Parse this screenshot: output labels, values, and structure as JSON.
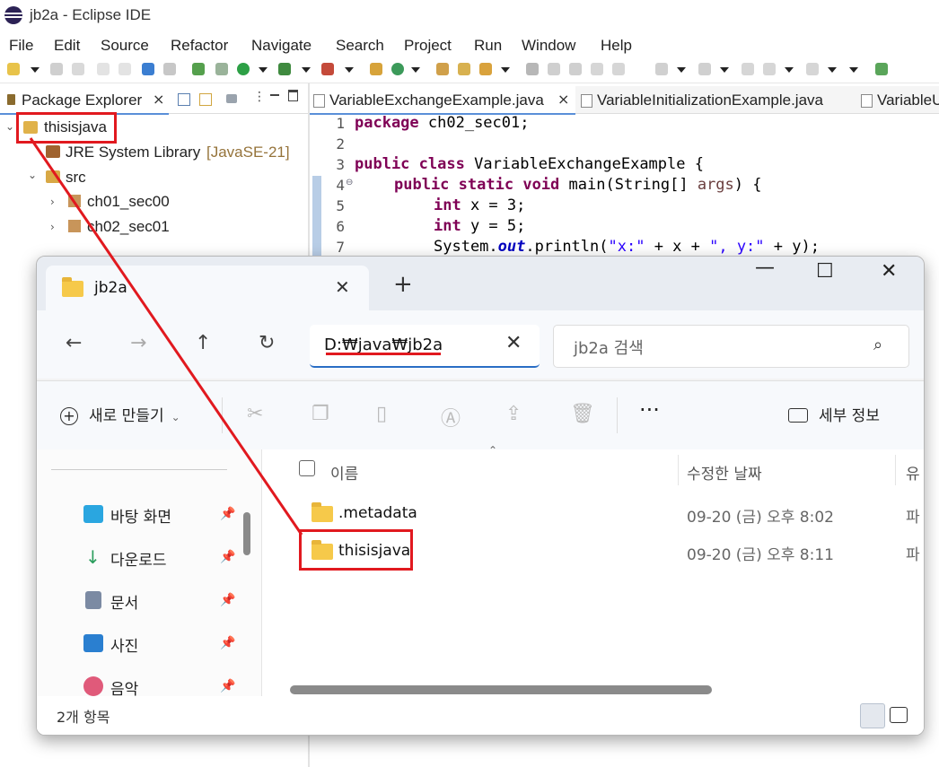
{
  "eclipse": {
    "window_title": "jb2a - Eclipse IDE",
    "menu": [
      "File",
      "Edit",
      "Source",
      "Refactor",
      "Navigate",
      "Search",
      "Project",
      "Run",
      "Window",
      "Help"
    ],
    "package_explorer": {
      "tab_label": "Package Explorer",
      "close": "×",
      "tree": {
        "project": "thisisjava",
        "jre": "JRE System Library",
        "jre_version": "[JavaSE-21]",
        "src": "src",
        "packages": [
          "ch01_sec00",
          "ch02_sec01"
        ]
      }
    },
    "editor": {
      "tabs": [
        "VariableExchangeExample.java",
        "VariableInitializationExample.java",
        "VariableU"
      ],
      "line_numbers": [
        "1",
        "2",
        "3",
        "4",
        "5",
        "6",
        "7"
      ],
      "code": {
        "l1_kw": "package",
        "l1_rest": " ch02_sec01;",
        "l3_kw1": "public",
        "l3_kw2": "class",
        "l3_rest": " VariableExchangeExample {",
        "l4_kw1": "public",
        "l4_kw2": "static",
        "l4_kw3": "void",
        "l4_rest1": " main(String[] ",
        "l4_param": "args",
        "l4_rest2": ") {",
        "l5_kw": "int",
        "l5_rest": " x = 3;",
        "l6_kw": "int",
        "l6_rest": " y = 5;",
        "l7_a": "System.",
        "l7_field": "out",
        "l7_b": ".println(",
        "l7_s1": "\"x:\"",
        "l7_c": " + x + ",
        "l7_s2": "\", y:\"",
        "l7_d": " + y);"
      }
    }
  },
  "explorer": {
    "tab_title": "jb2a",
    "tab_close": "✕",
    "new_tab": "+",
    "window_buttons": {
      "minimize": "—",
      "maximize": "☐",
      "close": "✕"
    },
    "nav": {
      "back": "←",
      "forward": "→",
      "up": "↑",
      "refresh": "↻"
    },
    "address": "D:₩java₩jb2a",
    "address_clear": "✕",
    "search_placeholder": "jb2a 검색",
    "command_bar": {
      "new_label": "새로 만들기",
      "more": "···",
      "details_label": "세부 정보"
    },
    "quick_access": [
      {
        "label": "바탕 화면",
        "color": "#2aa6e0"
      },
      {
        "label": "다운로드",
        "color": "#2a9d5c"
      },
      {
        "label": "문서",
        "color": "#7b8aa3"
      },
      {
        "label": "사진",
        "color": "#2a7fd0"
      },
      {
        "label": "음악",
        "color": "#e05a7a"
      }
    ],
    "columns": {
      "name": "이름",
      "modified": "수정한 날짜",
      "type": "유"
    },
    "files": [
      {
        "name": ".metadata",
        "modified": "09-20 (금) 오후 8:02",
        "type": "파"
      },
      {
        "name": "thisisjava",
        "modified": "09-20 (금) 오후 8:11",
        "type": "파"
      }
    ],
    "status": "2개 항목"
  },
  "colors": {
    "annotation": "#e1191f",
    "accent": "#2a6ec5",
    "folder": "#f6c94a"
  }
}
